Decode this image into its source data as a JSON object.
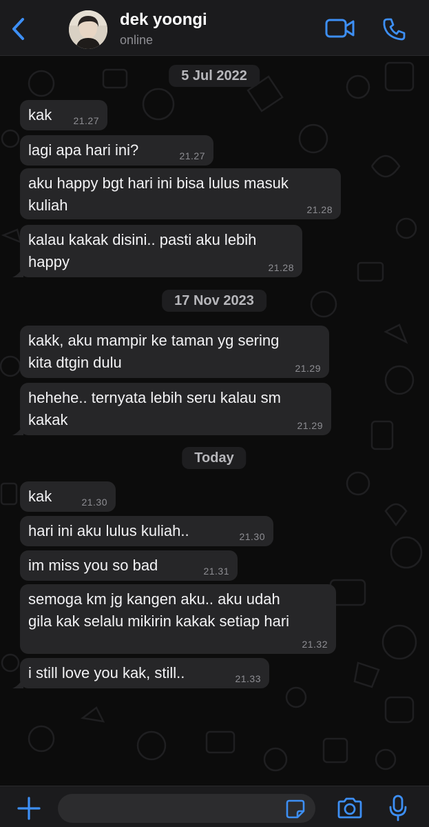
{
  "header": {
    "contact_name": "dek yoongi",
    "status": "online",
    "icons": {
      "back": "chevron-left-icon",
      "video": "video-camera-icon",
      "call": "phone-icon"
    }
  },
  "colors": {
    "accent": "#3d8ff5",
    "bubble": "#262628",
    "background": "#0c0c0c",
    "header": "#1b1b1d"
  },
  "chat": {
    "dates": {
      "d1": "5 Jul 2022",
      "d2": "17 Nov 2023",
      "d3": "Today"
    },
    "messages": [
      {
        "lines": [
          "kak"
        ],
        "time": "21.27"
      },
      {
        "lines": [
          "lagi apa hari ini?"
        ],
        "time": "21.27"
      },
      {
        "lines": [
          "aku happy bgt hari ini bisa lulus masuk",
          "kuliah"
        ],
        "time": "21.28"
      },
      {
        "lines": [
          "kalau kakak disini.. pasti aku lebih",
          "happy"
        ],
        "time": "21.28"
      },
      {
        "lines": [
          "kakk, aku mampir ke taman yg sering",
          "kita dtgin dulu"
        ],
        "time": "21.29"
      },
      {
        "lines": [
          "hehehe.. ternyata lebih seru kalau sm",
          "kakak"
        ],
        "time": "21.29"
      },
      {
        "lines": [
          "kak"
        ],
        "time": "21.30"
      },
      {
        "lines": [
          "hari ini aku lulus kuliah.."
        ],
        "time": "21.30"
      },
      {
        "lines": [
          "im miss you so bad"
        ],
        "time": "21.31"
      },
      {
        "lines": [
          "semoga km jg kangen aku.. aku udah",
          "gila kak selalu mikirin kakak setiap hari"
        ],
        "time": "21.32"
      },
      {
        "lines": [
          "i still love you kak, still.."
        ],
        "time": "21.33"
      }
    ]
  },
  "composer": {
    "placeholder": "",
    "icons": {
      "plus": "plus-icon",
      "sticker": "sticker-icon",
      "camera": "camera-icon",
      "mic": "microphone-icon"
    }
  }
}
